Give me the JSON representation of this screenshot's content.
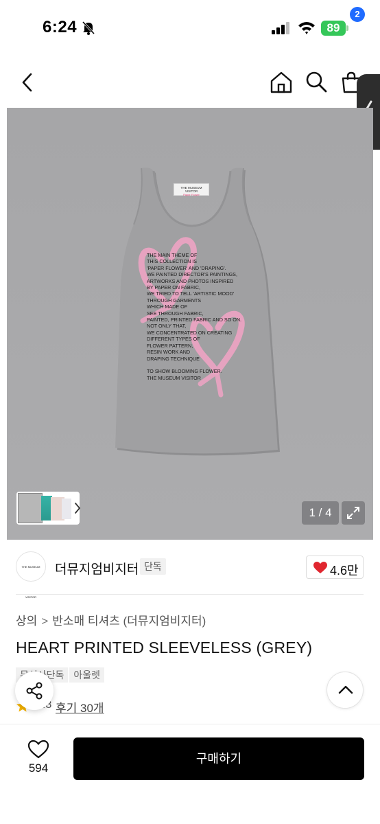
{
  "status_bar": {
    "time": "6:24",
    "battery": "89"
  },
  "header": {
    "cart_count": "2"
  },
  "image": {
    "counter": "1 / 4",
    "print_lines": [
      "THE MAIN THEME OF",
      "THIS COLLECTION IS",
      "'PAPER FLOWER' AND 'DRAPING'.",
      "WE PAINTED DIRECTOR'S PAINTINGS,",
      "ARTWORKS AND PHOTOS INSPIRED",
      "BY PAPER ON FABRIC,",
      "WE TRIED TO TELL 'ARTISTIC MOOD'",
      "THROUGH GARMENTS",
      "WHICH MADE OF",
      "SEE THROUGH FABRIC,",
      "PAINTED, PRINTED FABRIC AND SO ON.",
      "NOT ONLY THAT,",
      "WE CONCENTRATED ON CREATING",
      "DIFFERENT TYPES OF",
      "FLOWER PATTERN,",
      "RESIN WORK AND",
      "DRAPING TECHNIQUE",
      "",
      "TO SHOW BLOOMING FLOWER.",
      "THE MUSEUM VISITOR"
    ],
    "tag_line1": "THE MUSEUM VISITOR",
    "tag_line2": "Paper Flower"
  },
  "brand": {
    "logo_text": "THE MUSEUM VISITOR",
    "name": "더뮤지엄비지터",
    "badge": "단독",
    "likes": "4.6만"
  },
  "breadcrumb": {
    "category": "상의",
    "separator": ">",
    "subcategory": "반소매 티셔츠 (더뮤지엄비지터)"
  },
  "product": {
    "title": "HEART PRINTED SLEEVELESS (GREY)",
    "tags": [
      "무신사단독",
      "아울렛"
    ],
    "rating": "4.8",
    "reviews": "후기 30개"
  },
  "bottom_bar": {
    "wish_count": "594",
    "buy_label": "구매하기"
  },
  "colors": {
    "accent_blue": "#1f6bff",
    "battery_green": "#35c759",
    "like_red": "#e0262f",
    "heart_pink": "#eaa3c2"
  }
}
